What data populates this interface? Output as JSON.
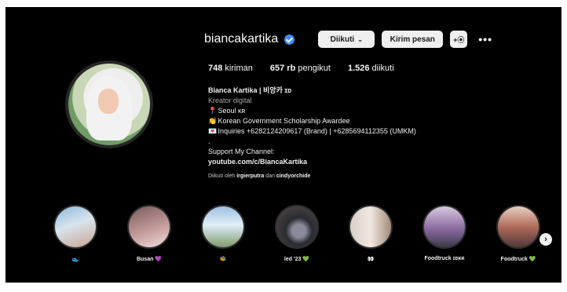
{
  "profile": {
    "username": "biancakartika",
    "follow_button": "Diikuti",
    "message_button": "Kirim pesan",
    "add_user_icon": "+⦿",
    "more_icon": "•••"
  },
  "stats": {
    "posts_value": "748",
    "posts_label": "kiriman",
    "followers_value": "657 rb",
    "followers_label": "pengikut",
    "following_value": "1.526",
    "following_label": "diikuti"
  },
  "bio": {
    "name": "Bianca Kartika | 비앙카 ɪᴅ",
    "category": "Kreator digital",
    "line_location_icon": "📍",
    "line_location": "Seoul ᴋʀ",
    "line_scholar_icon": "👏",
    "line_scholar": "Korean Government Scholarship Awardee",
    "line_inquiry_icon": "💌",
    "line_inquiry": "Inquiries +6282124209617 (Brand) | +6285694112355 (UMKM)",
    "dot": ".",
    "support": "Support My Channel:",
    "link": "youtube.com/c/BiancaKartika",
    "followed_prefix": "Diikuti oleh",
    "followed_user1": "irgierputra",
    "followed_and": "dan",
    "followed_user2": "cindyorchide"
  },
  "highlights": [
    {
      "label": "👟",
      "colors": [
        "#8fb8d8",
        "#c9a48f"
      ]
    },
    {
      "label": "Busan 💜",
      "colors": [
        "#7a5a5a",
        "#c8a0a0"
      ]
    },
    {
      "label": "🐝",
      "colors": [
        "#9fc0e0",
        "#7e9a6a"
      ]
    },
    {
      "label": "led '23 💚",
      "colors": [
        "#2a2a32",
        "#8a8a9a"
      ]
    },
    {
      "label": "👀",
      "colors": [
        "#d8d0c8",
        "#a48a7a"
      ]
    },
    {
      "label": "Foodtruck ɪᴅᴋʀ",
      "colors": [
        "#d8c8e0",
        "#8a6aa0"
      ]
    },
    {
      "label": "Foodtruck 💚",
      "colors": [
        "#e8d0c0",
        "#b06a5a"
      ]
    }
  ],
  "next_icon": "›"
}
